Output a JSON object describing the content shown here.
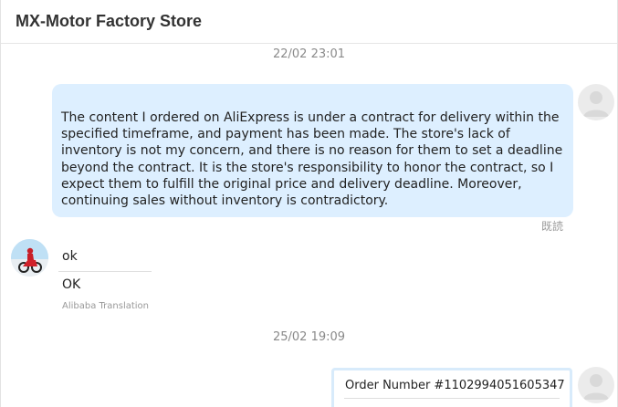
{
  "header": {
    "title": "MX-Motor Factory Store"
  },
  "conversation": {
    "timestamps": [
      "22/02 23:01",
      "25/02 19:09"
    ],
    "messages": [
      {
        "side": "right",
        "text": "The content I ordered on AliExpress is under a contract for delivery within the specified timeframe, and payment has been made. The store's lack of inventory is not my concern, and there is no reason for them to set a deadline beyond the contract. It is the store's responsibility to honor the contract, so I expect them to fulfill the original price and delivery deadline. Moreover, continuing sales without inventory is contradictory.",
        "status": "既読"
      },
      {
        "side": "left",
        "text": "ok",
        "translation": "OK",
        "translation_source": "Alibaba Translation"
      },
      {
        "side": "right",
        "type": "order-card",
        "order_label": "Order Number #1102994051605347"
      }
    ]
  },
  "colors": {
    "bubble_blue": "#ddefff",
    "card_border": "#d8ebfb",
    "timestamp_gray": "#8a8a8a"
  },
  "icons": {
    "user_avatar": "default-user-avatar-icon",
    "store_avatar": "motorcycle-rider-avatar"
  }
}
